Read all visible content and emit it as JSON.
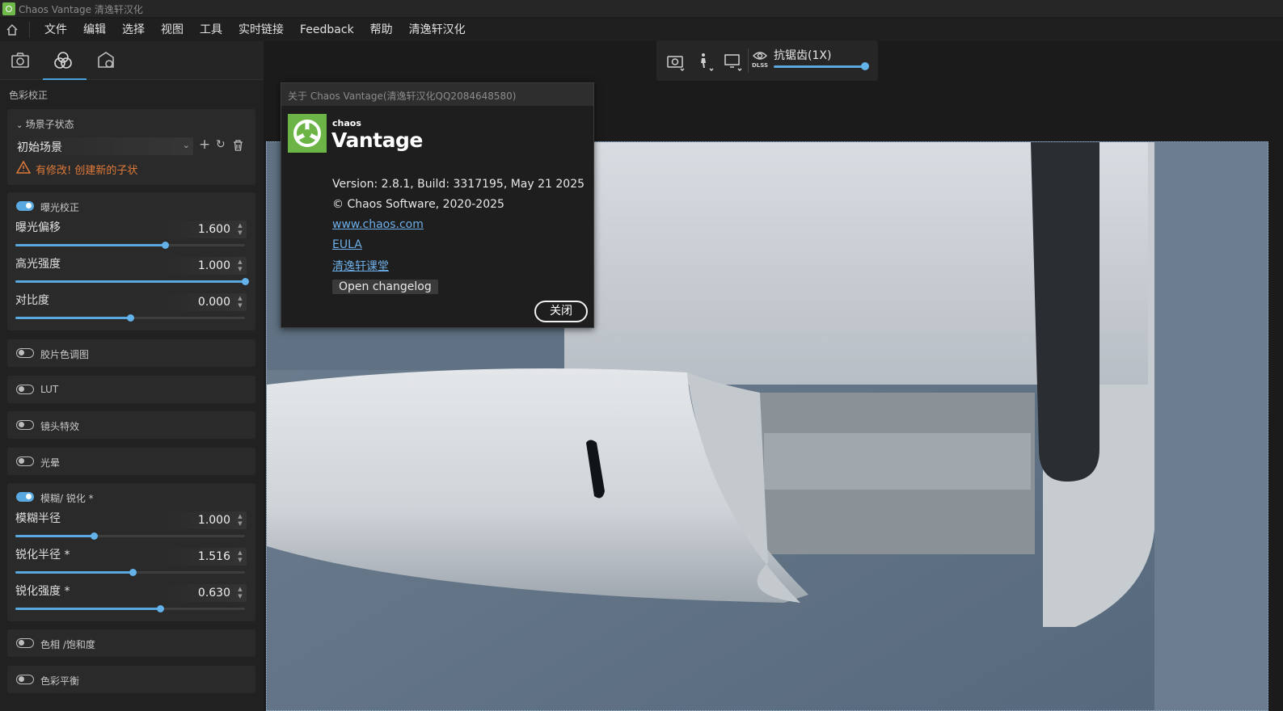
{
  "window": {
    "title": "Chaos Vantage 清逸轩汉化"
  },
  "menu": {
    "items": [
      "文件",
      "编辑",
      "选择",
      "视图",
      "工具",
      "实时链接",
      "Feedback",
      "帮助",
      "清逸轩汉化"
    ]
  },
  "left_panel": {
    "title": "色彩校正",
    "scene_state": {
      "header": "场景子状态",
      "current": "初始场景",
      "warning": "有修改! 创建新的子状"
    },
    "exposure": {
      "label": "曝光校正",
      "enabled": true,
      "params": [
        {
          "label": "曝光偏移",
          "value": "1.600",
          "fraction": 0.65
        },
        {
          "label": "高光强度",
          "value": "1.000",
          "fraction": 1.0
        },
        {
          "label": "对比度",
          "value": "0.000",
          "fraction": 0.5
        }
      ]
    },
    "toggles_a": [
      {
        "label": "胶片色调图",
        "enabled": false
      },
      {
        "label": "LUT",
        "enabled": false
      },
      {
        "label": "镜头特效",
        "enabled": false
      },
      {
        "label": "光晕",
        "enabled": false
      }
    ],
    "blur_sharpen": {
      "label": "模糊/ 锐化 *",
      "enabled": true,
      "params": [
        {
          "label": "模糊半径",
          "value": "1.000",
          "fraction": 0.34
        },
        {
          "label": "锐化半径 *",
          "value": "1.516",
          "fraction": 0.51
        },
        {
          "label": "锐化强度 *",
          "value": "0.630",
          "fraction": 0.63
        }
      ]
    },
    "toggles_b": [
      {
        "label": "色相 /饱和度",
        "enabled": false
      },
      {
        "label": "色彩平衡",
        "enabled": false
      }
    ]
  },
  "toolbar": {
    "antialias_label": "抗锯齿(1X)",
    "dlss_label": "DLSS",
    "antialias_level": 1.0
  },
  "about": {
    "title": "关于 Chaos Vantage(清逸轩汉化QQ2084648580)",
    "brand_small": "chaos",
    "brand_big": "Vantage",
    "version": "Version: 2.8.1, Build: 3317195, May 21 2025",
    "copyright": "© Chaos Software, 2020-2025",
    "website": "www.chaos.com",
    "eula": "EULA",
    "course": "清逸轩课堂",
    "changelog_button": "Open changelog",
    "close_button": "关闭"
  },
  "colors": {
    "accent": "#5aa8e0",
    "warning": "#e07a3a",
    "brand_green": "#6cb446"
  }
}
